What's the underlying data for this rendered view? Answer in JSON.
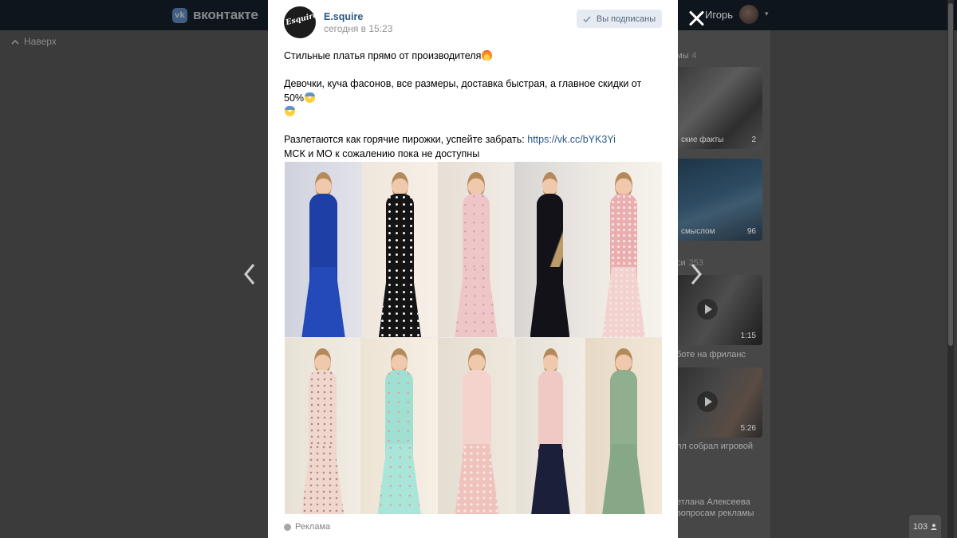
{
  "background": {
    "brand": "вконтакте",
    "scroll_up": "Наверх",
    "user_name": "Игорь",
    "side_headings": [
      {
        "label": "мы",
        "count": "4"
      },
      {
        "label": "си",
        "count": "253"
      }
    ],
    "side_cards": [
      {
        "caption": "ские факты",
        "count": "2"
      },
      {
        "caption": "смыслом",
        "count": "96"
      },
      {
        "caption": "",
        "count": "1:15"
      },
      {
        "caption": "",
        "count": "5:26"
      }
    ],
    "side_texts": [
      "боте на фриланс",
      "лл собрал игровой",
      "етлана Алексеева",
      "вопросам рекламы"
    ],
    "online_count": "103"
  },
  "post": {
    "author": "E.squire",
    "avatar_text": "Esquire",
    "date": "сегодня в 15:23",
    "subscribe_label": "Вы подписаны",
    "lines": {
      "l1": "Стильные платья прямо от производителя",
      "l2": "Девочки, куча фасонов, все размеры, доставка быстрая, а главное скидки от 50%",
      "l3_prefix": "Разлетаются как горячие пирожки, успейте забрать: ",
      "l3_link": "https://vk.cc/bYK3Yi",
      "l4": "МСК и МО к сожалению пока не доступны"
    },
    "ad_label": "Реклама"
  },
  "colors": {
    "link": "#2a5885",
    "overlay": "#3b3b3b",
    "subscribe_bg": "#e5ebf1"
  },
  "icons": {
    "close": "close-icon",
    "prev": "chevron-left-icon",
    "next": "chevron-right-icon",
    "check": "check-icon",
    "ad": "ad-info-icon",
    "person": "person-icon"
  }
}
